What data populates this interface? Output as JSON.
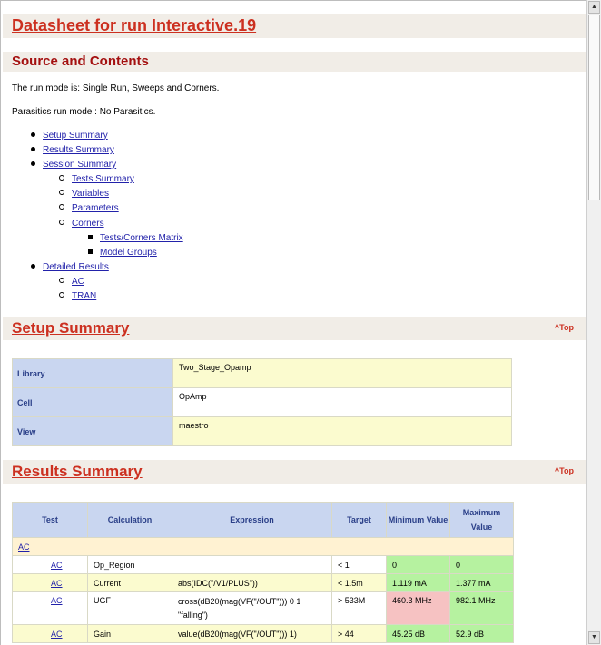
{
  "title": "Datasheet for run Interactive.19",
  "source": {
    "heading": "Source and Contents",
    "run_mode": "The run mode is: Single Run, Sweeps and Corners.",
    "parasitics": "Parasitics run mode : No Parasitics."
  },
  "toc": {
    "setup": "Setup Summary",
    "results": "Results Summary",
    "session": "Session Summary",
    "tests": "Tests Summary",
    "variables": "Variables",
    "parameters": "Parameters",
    "corners": "Corners",
    "tests_corners": "Tests/Corners Matrix",
    "model_groups": "Model Groups",
    "detailed": "Detailed Results",
    "ac": "AC",
    "tran": "TRAN"
  },
  "top_link": "^Top",
  "setup_summary": {
    "heading": "Setup Summary",
    "rows": [
      {
        "key": "Library",
        "value": "Two_Stage_Opamp"
      },
      {
        "key": "Cell",
        "value": "OpAmp"
      },
      {
        "key": "View",
        "value": "maestro"
      }
    ]
  },
  "results_summary": {
    "heading": "Results Summary",
    "headers": {
      "test": "Test",
      "calculation": "Calculation",
      "expression": "Expression",
      "target": "Target",
      "minimum": "Minimum Value",
      "maximum": "Maximum Value"
    },
    "group": "AC",
    "rows": [
      {
        "test": "AC",
        "calc": "Op_Region",
        "expr": "",
        "target": "< 1",
        "min": "0",
        "max": "0"
      },
      {
        "test": "AC",
        "calc": "Current",
        "expr": "abs(IDC(\"/V1/PLUS\"))",
        "target": "< 1.5m",
        "min": "1.119 mA",
        "max": "1.377 mA"
      },
      {
        "test": "AC",
        "calc": "UGF",
        "expr": "cross(dB20(mag(VF(\"/OUT\"))) 0 1 \"falling\")",
        "target": "> 533M",
        "min": "460.3 MHz",
        "max": "982.1 MHz"
      },
      {
        "test": "AC",
        "calc": "Gain",
        "expr": "value(dB20(mag(VF(\"/OUT\"))) 1)",
        "target": "> 44",
        "min": "45.25 dB",
        "max": "52.9 dB"
      }
    ]
  }
}
